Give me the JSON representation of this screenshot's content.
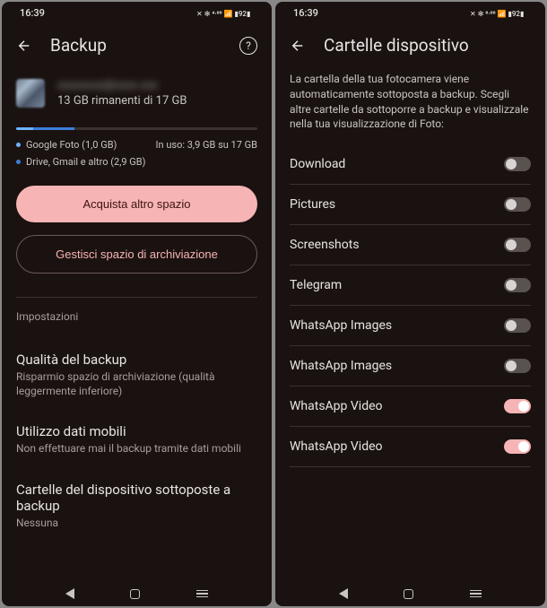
{
  "statusbar": {
    "time": "16:39",
    "right_icons": "✕ ✻ 4.00 ⚲ 📶 ⌇92⌇",
    "right_text": "92"
  },
  "left": {
    "title": "Backup",
    "account_email": "xxxxxxxx@xxxx.xxx",
    "storage_text": "13 GB rimanenti di 17 GB",
    "usage_photo": "Google Foto (1,0 GB)",
    "usage_total": "In uso: 3,9 GB su 17 GB",
    "usage_drive": "Drive, Gmail e altro (2,9 GB)",
    "btn_buy": "Acquista altro spazio",
    "btn_manage": "Gestisci spazio di archiviazione",
    "section_label": "Impostazioni",
    "settings": [
      {
        "title": "Qualità del backup",
        "sub": "Risparmio spazio di archiviazione (qualità leggermente inferiore)"
      },
      {
        "title": "Utilizzo dati mobili",
        "sub": "Non effettuare mai il backup tramite dati mobili"
      },
      {
        "title": "Cartelle del dispositivo sottoposte a backup",
        "sub": "Nessuna"
      }
    ]
  },
  "right": {
    "title": "Cartelle dispositivo",
    "description": "La cartella della tua fotocamera viene automaticamente sottoposta a backup. Scegli altre cartelle da sottoporre a backup e visualizzale nella tua visualizzazione di Foto:",
    "folders": [
      {
        "name": "Download",
        "on": false
      },
      {
        "name": "Pictures",
        "on": false
      },
      {
        "name": "Screenshots",
        "on": false
      },
      {
        "name": "Telegram",
        "on": false
      },
      {
        "name": "WhatsApp Images",
        "on": false
      },
      {
        "name": "WhatsApp Images",
        "on": false
      },
      {
        "name": "WhatsApp Video",
        "on": true
      },
      {
        "name": "WhatsApp Video",
        "on": true
      }
    ]
  }
}
